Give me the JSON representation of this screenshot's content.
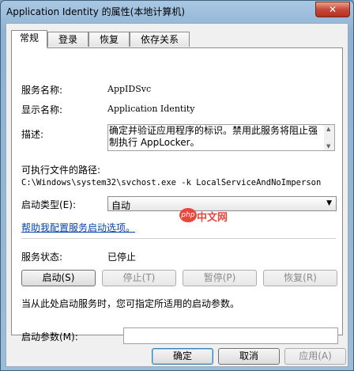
{
  "window": {
    "title": "Application Identity 的属性(本地计算机)",
    "close_label": "✕"
  },
  "tabs": [
    {
      "label": "常规",
      "active": true
    },
    {
      "label": "登录",
      "active": false
    },
    {
      "label": "恢复",
      "active": false
    },
    {
      "label": "依存关系",
      "active": false
    }
  ],
  "general": {
    "service_name_label": "服务名称:",
    "service_name_value": "AppIDSvc",
    "display_name_label": "显示名称:",
    "display_name_value": "Application Identity",
    "description_label": "描述:",
    "description_value": "确定并验证应用程序的标识。禁用此服务将阻止强制执行 AppLocker。",
    "exec_path_label": "可执行文件的路径:",
    "exec_path_value": "C:\\Windows\\system32\\svchost.exe -k LocalServiceAndNoImperson",
    "startup_type_label": "启动类型(E):",
    "startup_type_value": "自动",
    "help_link": "帮助我配置服务启动选项。",
    "status_label": "服务状态:",
    "status_value": "已停止",
    "hint_text": "当从此处启动服务时，您可指定所适用的启动参数。",
    "start_params_label": "启动参数(M):",
    "start_params_value": ""
  },
  "service_buttons": {
    "start": "启动(S)",
    "stop": "停止(T)",
    "pause": "暂停(P)",
    "resume": "恢复(R)"
  },
  "dialog_buttons": {
    "ok": "确定",
    "cancel": "取消",
    "apply": "应用(A)"
  },
  "watermark": {
    "logo": "php",
    "text": "中文网"
  },
  "colors": {
    "link": "#0645ad",
    "close": "#c7493a",
    "watermark": "#e8453c"
  }
}
